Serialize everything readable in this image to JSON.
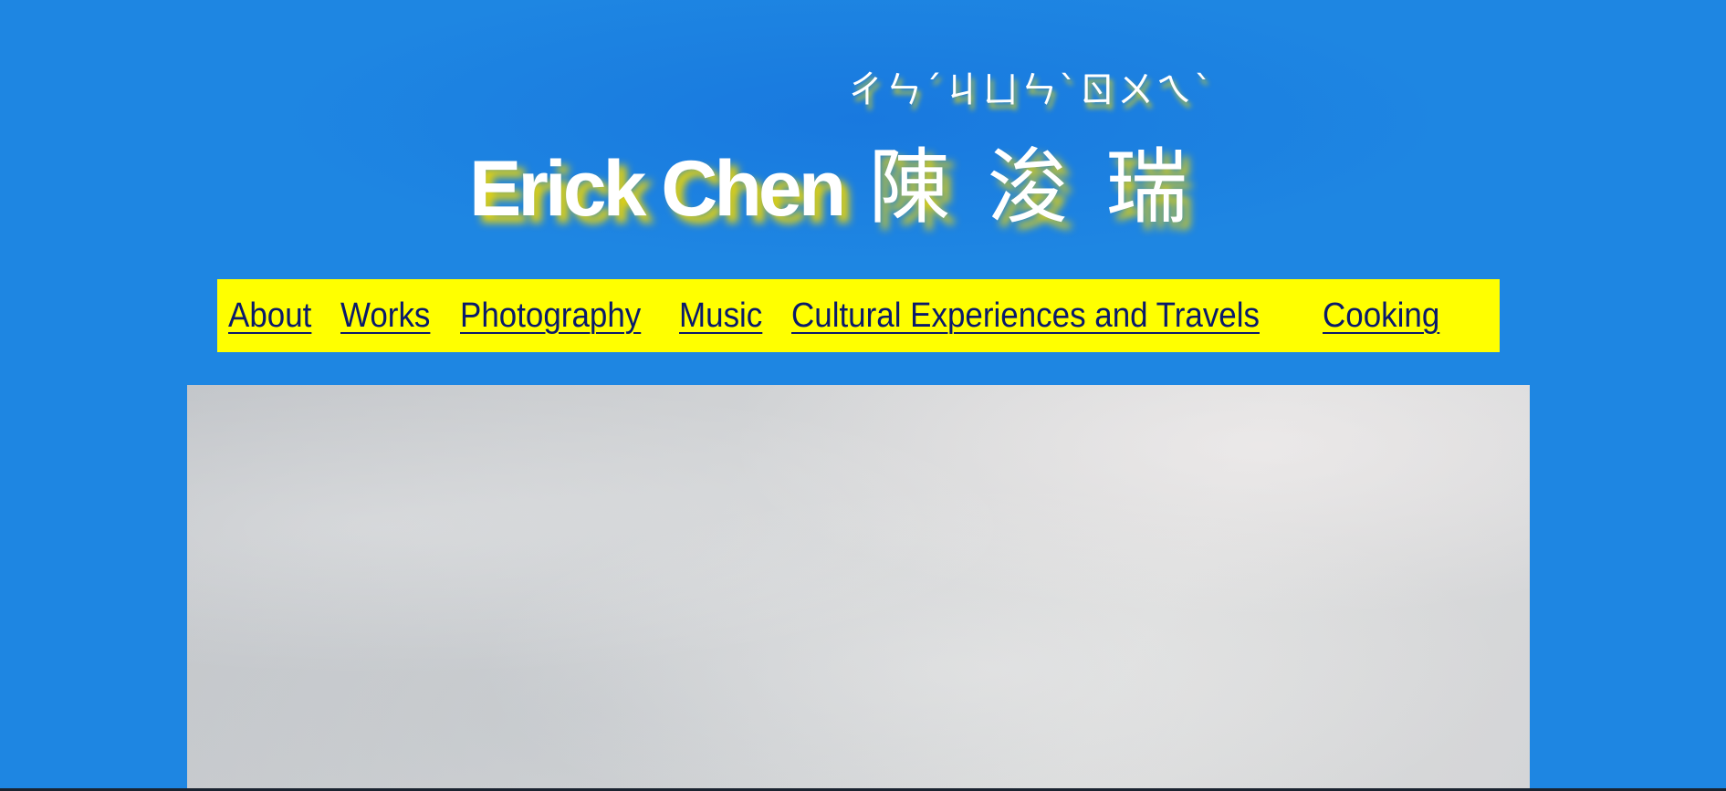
{
  "header": {
    "bopomofo": "ㄔㄣˊㄐㄩㄣˋㄖㄨㄟˋ",
    "title_en": "Erick Chen",
    "title_zh": "陳浚瑞"
  },
  "nav": {
    "items": [
      {
        "label": "About "
      },
      {
        "label": "Works "
      },
      {
        "label": "Photography "
      },
      {
        "label": "Music "
      },
      {
        "label": "Cultural Experiences and Travels "
      },
      {
        "label": "Cooking"
      }
    ]
  },
  "colors": {
    "background": "#1e86e2",
    "nav_background": "#ffff00",
    "nav_link": "#0a1a6b",
    "title_text": "#ffffff",
    "title_shadow": "#f0d700"
  },
  "hero": {
    "icon": "cloudy-sky-photo"
  }
}
